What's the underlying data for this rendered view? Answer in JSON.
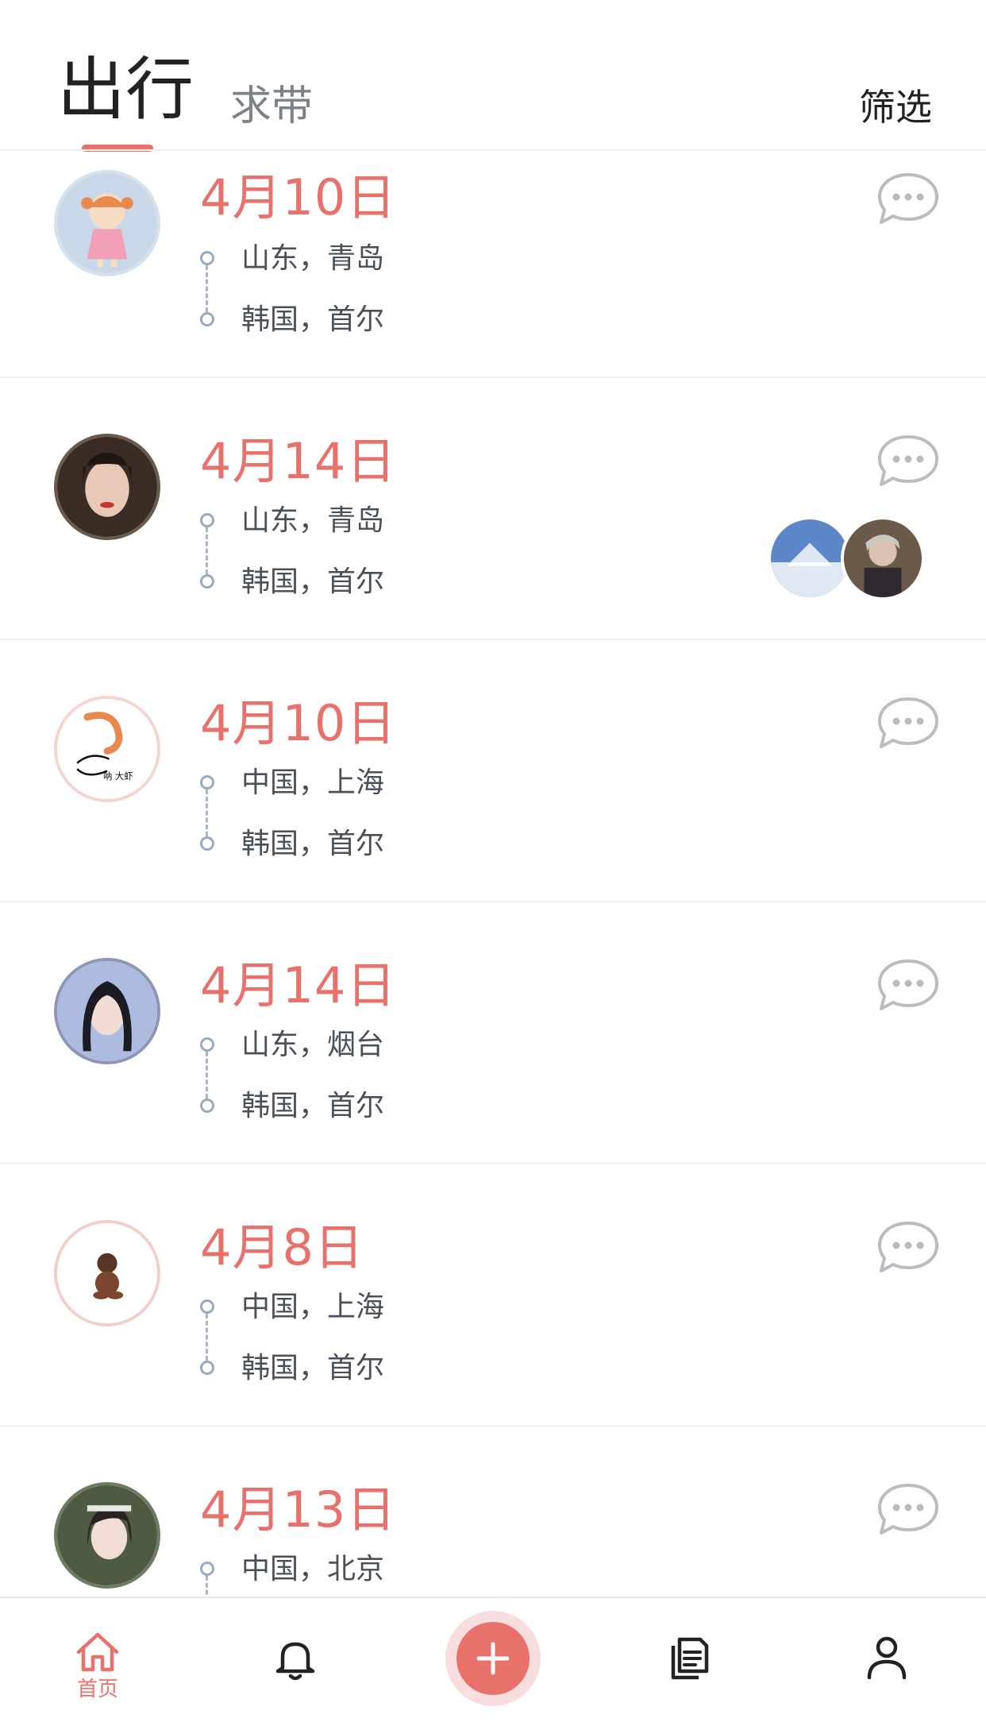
{
  "header": {
    "tabs": [
      {
        "label": "出行",
        "active": true
      },
      {
        "label": "求带",
        "active": false
      }
    ],
    "filter_label": "筛选"
  },
  "colors": {
    "accent": "#e9716c",
    "route_gray": "#9aaabf",
    "chat_icon": "#b9bdc2",
    "divider": "#eeeeee"
  },
  "trips": [
    {
      "date": "4月10日",
      "from": "山东，青岛",
      "to": "韩国，首尔",
      "avatar_icon": "cartoon-girl-avatar",
      "chat_icon": "chat-bubble-icon"
    },
    {
      "date": "4月14日",
      "from": "山东，青岛",
      "to": "韩国，首尔",
      "avatar_icon": "girl-photo-avatar",
      "chat_icon": "chat-bubble-icon",
      "companions": [
        "sky-photo-avatar",
        "person-photo-avatar"
      ]
    },
    {
      "date": "4月10日",
      "from": "中国，上海",
      "to": "韩国，首尔",
      "avatar_icon": "shrimp-avatar",
      "avatar_caption": "呐 大虾",
      "chat_icon": "chat-bubble-icon"
    },
    {
      "date": "4月14日",
      "from": "山东，烟台",
      "to": "韩国，首尔",
      "avatar_icon": "girl-photo-avatar",
      "chat_icon": "chat-bubble-icon"
    },
    {
      "date": "4月8日",
      "from": "中国，上海",
      "to": "韩国，首尔",
      "avatar_icon": "baby-avatar",
      "chat_icon": "chat-bubble-icon"
    },
    {
      "date": "4月13日",
      "from": "中国，北京",
      "to": "",
      "avatar_icon": "girl-photo-avatar",
      "chat_icon": "chat-bubble-icon"
    }
  ],
  "bottom_nav": [
    {
      "icon": "home-icon",
      "label": "首页",
      "active": true
    },
    {
      "icon": "bell-icon",
      "label": "",
      "active": false
    },
    {
      "icon": "plus-icon",
      "label": "",
      "active": false
    },
    {
      "icon": "document-icon",
      "label": "",
      "active": false
    },
    {
      "icon": "user-icon",
      "label": "",
      "active": false
    }
  ]
}
